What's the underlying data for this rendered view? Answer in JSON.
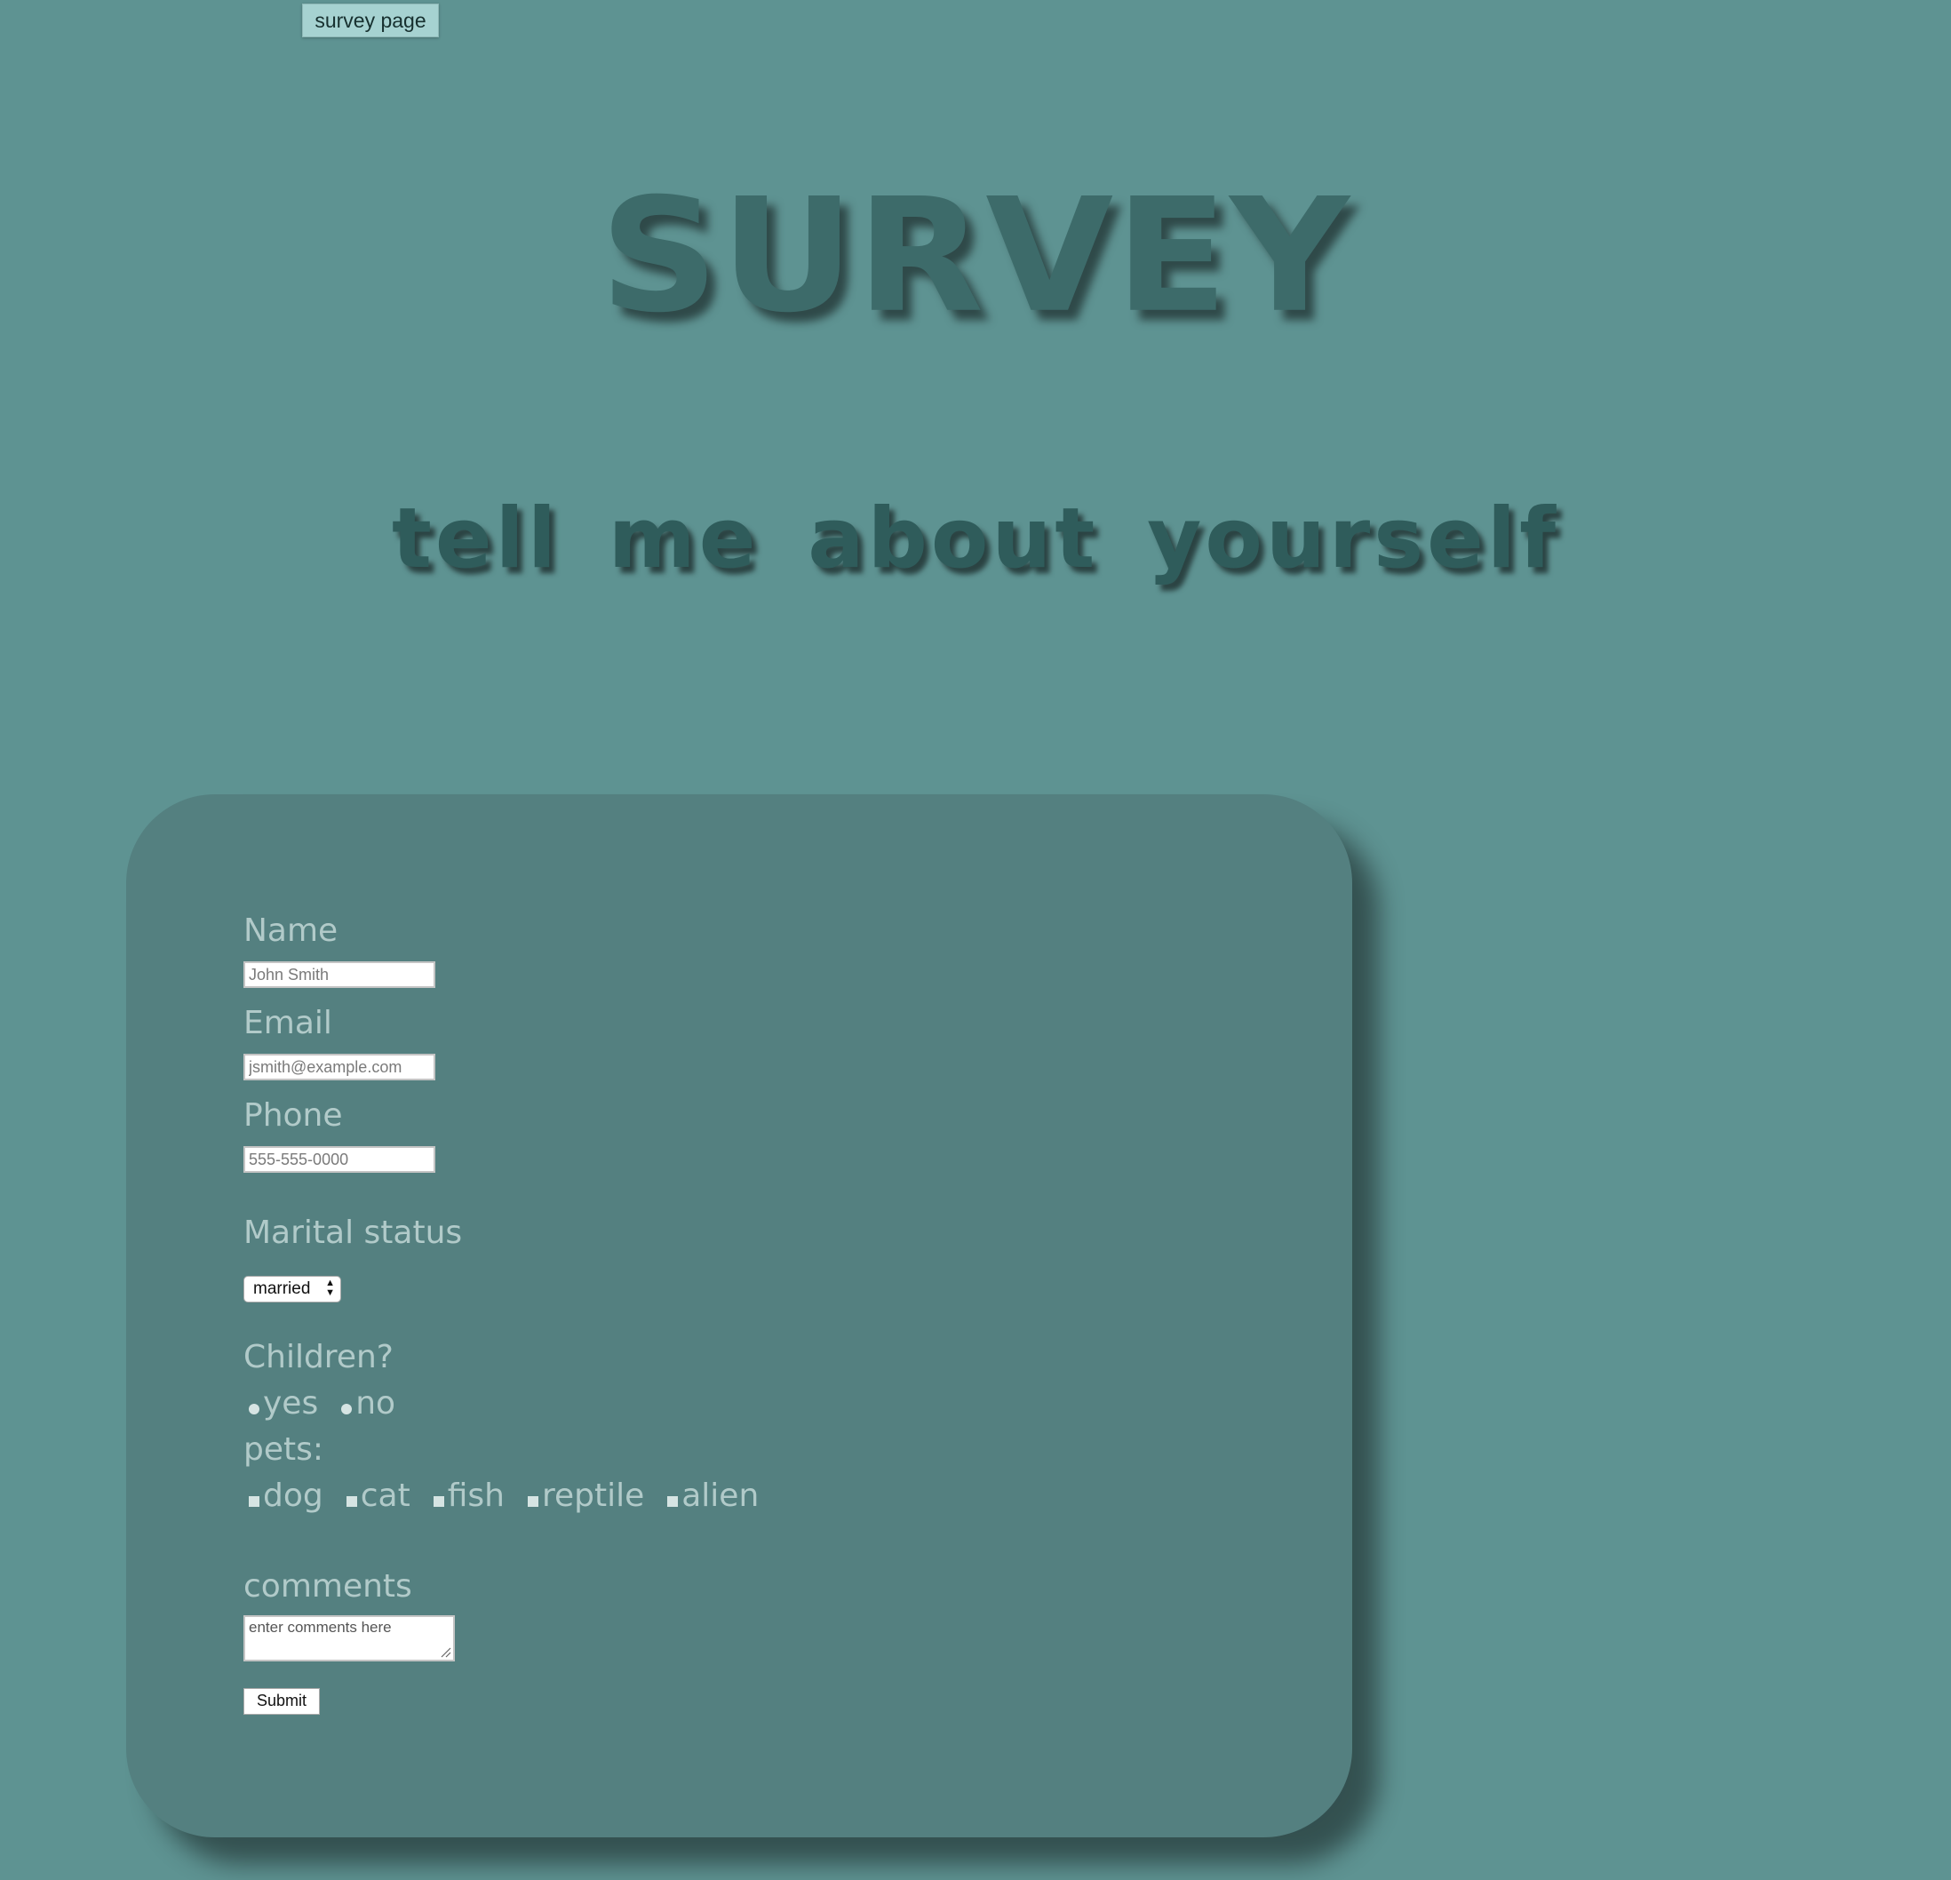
{
  "tab": {
    "label": "survey page"
  },
  "header": {
    "title": "SURVEY",
    "subtitle": "tell me about yourself"
  },
  "form": {
    "name": {
      "label": "Name",
      "placeholder": "John Smith"
    },
    "email": {
      "label": "Email",
      "placeholder": "jsmith@example.com"
    },
    "phone": {
      "label": "Phone",
      "placeholder": "555-555-0000"
    },
    "marital": {
      "label": "Marital status",
      "selected": "married"
    },
    "children": {
      "label": "Children?",
      "options": [
        "yes",
        "no"
      ]
    },
    "pets": {
      "label": "pets:",
      "options": [
        "dog",
        "cat",
        "fish",
        "reptile",
        "alien"
      ]
    },
    "comments": {
      "label": "comments",
      "placeholder": "enter comments here"
    },
    "submit_label": "Submit"
  },
  "colors": {
    "background": "#5e9392",
    "card": "#548080",
    "title": "#3d6b6a",
    "subtitle": "#2f5c5b",
    "label": "#b1cac9",
    "tab": "#a6d2d1"
  }
}
